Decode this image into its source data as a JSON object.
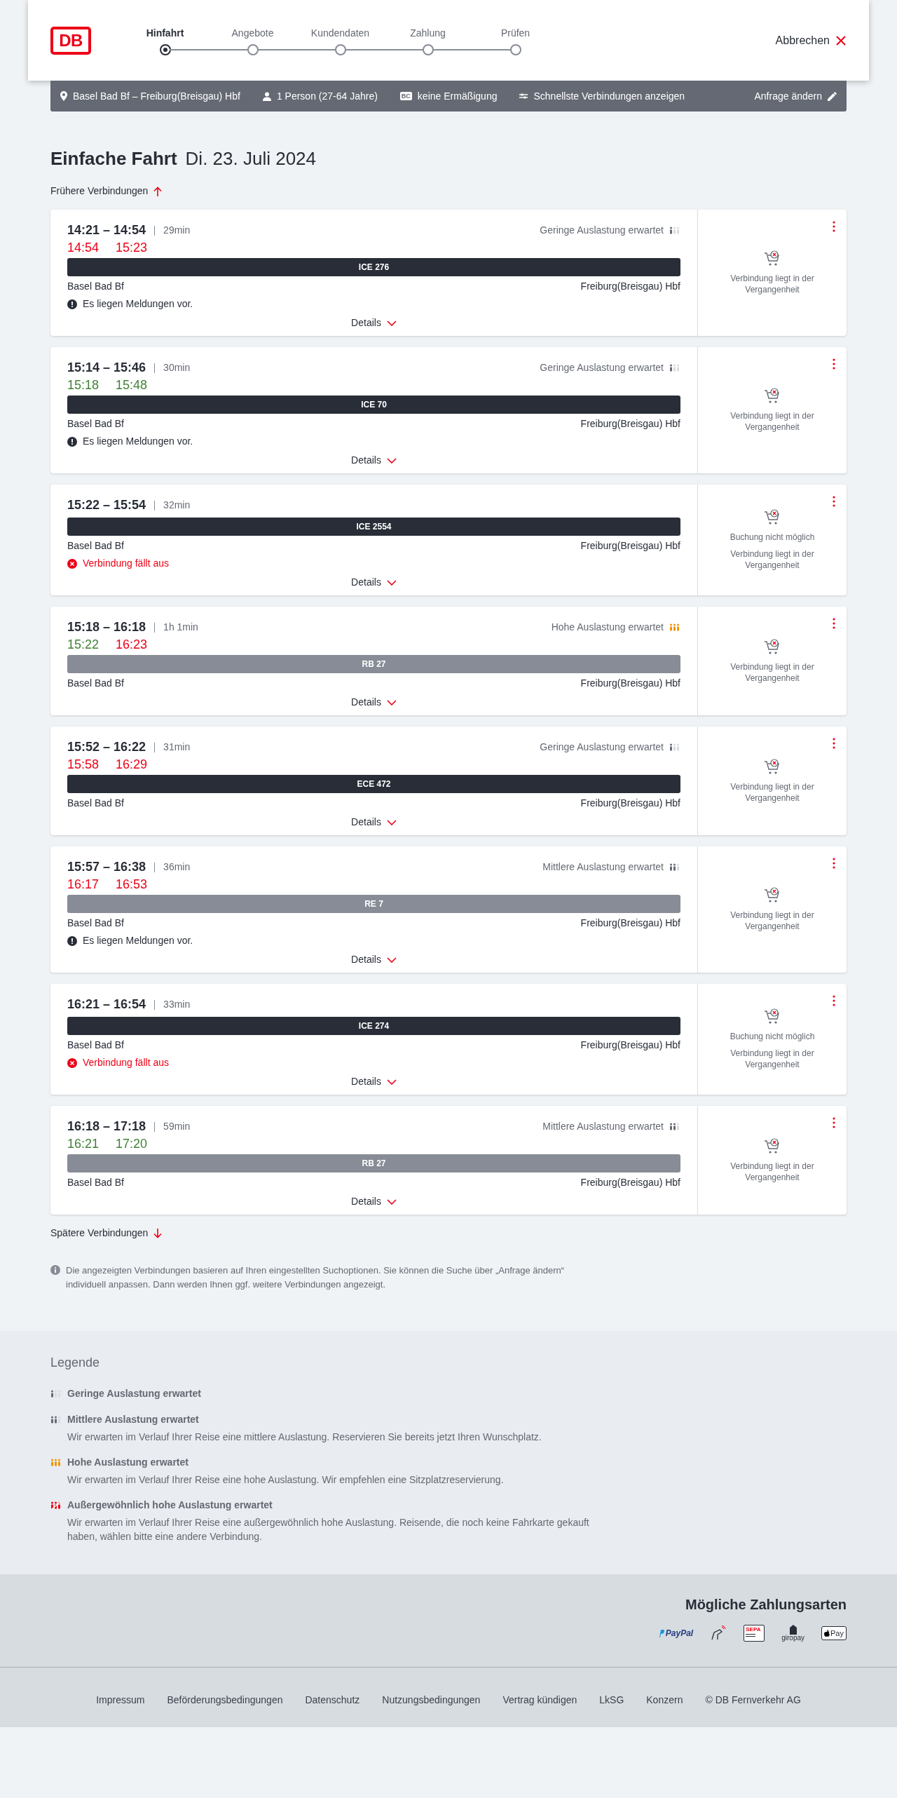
{
  "header": {
    "logo": "DB",
    "steps": [
      {
        "label": "Hinfahrt",
        "selected": true
      },
      {
        "label": "Angebote",
        "selected": false
      },
      {
        "label": "Kundendaten",
        "selected": false
      },
      {
        "label": "Zahlung",
        "selected": false
      },
      {
        "label": "Prüfen",
        "selected": false
      }
    ],
    "cancel": "Abbrechen"
  },
  "search_bar": {
    "route": "Basel Bad Bf – Freiburg(Breisgau) Hbf",
    "passengers": "1 Person (27-64 Jahre)",
    "discount": "keine Ermäßigung",
    "discount_badge": "BC",
    "option": "Schnellste Verbindungen anzeigen",
    "change": "Anfrage ändern"
  },
  "title": "Einfache Fahrt",
  "date": "Di. 23. Juli 2024",
  "earlier": "Frühere Verbindungen",
  "connections": [
    {
      "time": "14:21 – 14:54",
      "duration": "29min",
      "occupancy": {
        "kind": "low",
        "text": "Geringe Auslastung erwartet"
      },
      "realtime": [
        {
          "time": "14:54",
          "late": true
        },
        {
          "time": "15:23",
          "late": true
        }
      ],
      "train": {
        "name": "ICE 276",
        "regional": false
      },
      "from": "Basel Bad Bf",
      "to": "Freiburg(Breisgau) Hbf",
      "notice": {
        "kind": "info",
        "text": "Es liegen Meldungen vor."
      },
      "details": "Details",
      "side": [
        "Verbindung liegt in der Vergangenheit"
      ]
    },
    {
      "time": "15:14 – 15:46",
      "duration": "30min",
      "occupancy": {
        "kind": "low",
        "text": "Geringe Auslastung erwartet"
      },
      "realtime": [
        {
          "time": "15:18",
          "late": false
        },
        {
          "time": "15:48",
          "late": false
        }
      ],
      "train": {
        "name": "ICE 70",
        "regional": false
      },
      "from": "Basel Bad Bf",
      "to": "Freiburg(Breisgau) Hbf",
      "notice": {
        "kind": "info",
        "text": "Es liegen Meldungen vor."
      },
      "details": "Details",
      "side": [
        "Verbindung liegt in der Vergangenheit"
      ]
    },
    {
      "time": "15:22 – 15:54",
      "duration": "32min",
      "train": {
        "name": "ICE 2554",
        "regional": false
      },
      "from": "Basel Bad Bf",
      "to": "Freiburg(Breisgau) Hbf",
      "notice": {
        "kind": "cancelled",
        "text": "Verbindung fällt aus"
      },
      "details": "Details",
      "side": [
        "Buchung nicht möglich",
        "Verbindung liegt in der Vergangenheit"
      ]
    },
    {
      "time": "15:18 – 16:18",
      "duration": "1h 1min",
      "occupancy": {
        "kind": "high",
        "text": "Hohe Auslastung erwartet"
      },
      "realtime": [
        {
          "time": "15:22",
          "late": false
        },
        {
          "time": "16:23",
          "late": true
        }
      ],
      "train": {
        "name": "RB 27",
        "regional": true
      },
      "from": "Basel Bad Bf",
      "to": "Freiburg(Breisgau) Hbf",
      "details": "Details",
      "side": [
        "Verbindung liegt in der Vergangenheit"
      ]
    },
    {
      "time": "15:52 – 16:22",
      "duration": "31min",
      "occupancy": {
        "kind": "low",
        "text": "Geringe Auslastung erwartet"
      },
      "realtime": [
        {
          "time": "15:58",
          "late": true
        },
        {
          "time": "16:29",
          "late": true
        }
      ],
      "train": {
        "name": "ECE 472",
        "regional": false
      },
      "from": "Basel Bad Bf",
      "to": "Freiburg(Breisgau) Hbf",
      "details": "Details",
      "side": [
        "Verbindung liegt in der Vergangenheit"
      ]
    },
    {
      "time": "15:57 – 16:38",
      "duration": "36min",
      "occupancy": {
        "kind": "medium",
        "text": "Mittlere Auslastung erwartet"
      },
      "realtime": [
        {
          "time": "16:17",
          "late": true
        },
        {
          "time": "16:53",
          "late": true
        }
      ],
      "train": {
        "name": "RE 7",
        "regional": true
      },
      "from": "Basel Bad Bf",
      "to": "Freiburg(Breisgau) Hbf",
      "notice": {
        "kind": "info",
        "text": "Es liegen Meldungen vor."
      },
      "details": "Details",
      "side": [
        "Verbindung liegt in der Vergangenheit"
      ]
    },
    {
      "time": "16:21 – 16:54",
      "duration": "33min",
      "train": {
        "name": "ICE 274",
        "regional": false
      },
      "from": "Basel Bad Bf",
      "to": "Freiburg(Breisgau) Hbf",
      "notice": {
        "kind": "cancelled",
        "text": "Verbindung fällt aus"
      },
      "details": "Details",
      "side": [
        "Buchung nicht möglich",
        "Verbindung liegt in der Vergangenheit"
      ]
    },
    {
      "time": "16:18 – 17:18",
      "duration": "59min",
      "occupancy": {
        "kind": "medium",
        "text": "Mittlere Auslastung erwartet"
      },
      "realtime": [
        {
          "time": "16:21",
          "late": false
        },
        {
          "time": "17:20",
          "late": false
        }
      ],
      "train": {
        "name": "RB 27",
        "regional": true
      },
      "from": "Basel Bad Bf",
      "to": "Freiburg(Breisgau) Hbf",
      "details": "Details",
      "side": [
        "Verbindung liegt in der Vergangenheit"
      ]
    }
  ],
  "later": "Spätere Verbindungen",
  "info": "Die angezeigten Verbindungen basieren auf Ihren eingestellten Suchoptionen. Sie können die Suche über „Anfrage ändern“ individuell anpassen. Dann werden Ihnen ggf. weitere Verbindungen angezeigt.",
  "legend": {
    "title": "Legende",
    "items": [
      {
        "kind": "low",
        "title": "Geringe Auslastung erwartet"
      },
      {
        "kind": "medium",
        "title": "Mittlere Auslastung erwartet",
        "text": "Wir erwarten im Verlauf Ihrer Reise eine mittlere Auslastung. Reservieren Sie bereits jetzt Ihren Wunschplatz."
      },
      {
        "kind": "high",
        "title": "Hohe Auslastung erwartet",
        "text": "Wir erwarten im Verlauf Ihrer Reise eine hohe Auslastung. Wir empfehlen eine Sitzplatzreservierung."
      },
      {
        "kind": "exceptional",
        "title": "Außergewöhnlich hohe Auslastung erwartet",
        "text": "Wir erwarten im Verlauf Ihrer Reise eine außergewöhnlich hohe Auslastung. Reisende, die noch keine Fahrkarte gekauft haben, wählen bitte eine andere Verbindung."
      }
    ]
  },
  "payment": {
    "title": "Mögliche Zahlungsarten",
    "methods": [
      {
        "kind": "paypal",
        "label": "PayPal"
      },
      {
        "kind": "card"
      },
      {
        "kind": "sepa",
        "label": "SEPA"
      },
      {
        "kind": "giropay",
        "label": "giropay"
      },
      {
        "kind": "applepay",
        "label": "Pay"
      }
    ]
  },
  "footer_links": [
    "Impressum",
    "Beförderungsbedingungen",
    "Datenschutz",
    "Nutzungsbedingungen",
    "Vertrag kündigen",
    "LkSG",
    "Konzern",
    "© DB Fernverkehr AG"
  ]
}
